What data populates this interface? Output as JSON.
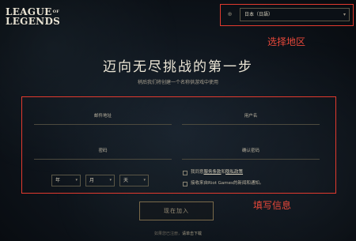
{
  "logo": {
    "line1": "LEAGUE",
    "of": "OF",
    "line2": "LEGENDS"
  },
  "region": {
    "globe_icon": "globe-icon",
    "selected": "日本（日語）"
  },
  "annotations": {
    "region": "选择地区",
    "form": "填写信息"
  },
  "heading": {
    "title": "迈向无尽挑战的第一步",
    "subtitle": "稍后我们将创建一个名称供游戏中使用"
  },
  "form": {
    "email_label": "邮件地址",
    "username_label": "用户名",
    "password_label": "密码",
    "confirm_password_label": "确认密码",
    "year": "年",
    "month": "月",
    "day": "天",
    "terms_prefix": "我同意",
    "terms_link": "服务条款",
    "terms_and": "和",
    "privacy_link": "隐私政策",
    "newsletter": "接收来自Riot Games的新闻和通知。"
  },
  "join_button": "现在加入",
  "footer": {
    "text": "如果您已注册，",
    "link": "请单击下载"
  },
  "colors": {
    "annotation": "#e23a2e",
    "background": "#0e141b"
  }
}
